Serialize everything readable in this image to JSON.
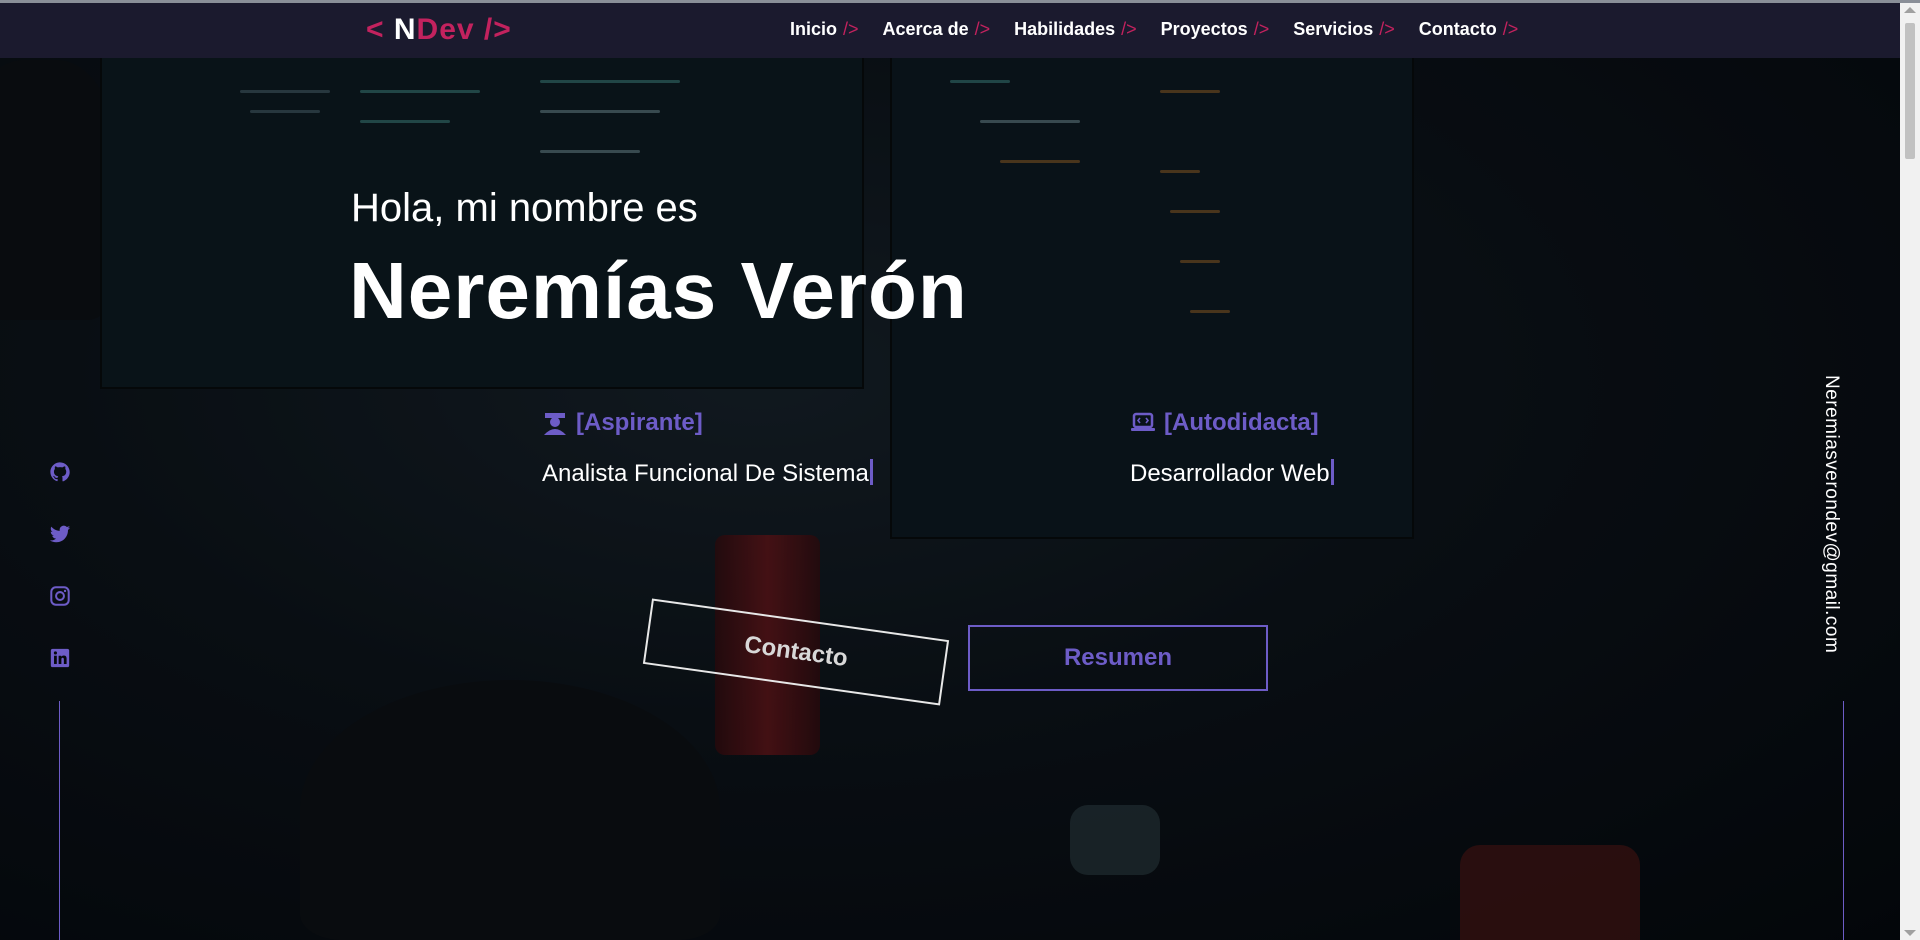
{
  "brand": {
    "left": "< ",
    "initial": "N",
    "rest": "Dev",
    "right": " />"
  },
  "nav": [
    {
      "label": "Inicio",
      "tag": "/>"
    },
    {
      "label": "Acerca de",
      "tag": "/>"
    },
    {
      "label": "Habilidades",
      "tag": "/>"
    },
    {
      "label": "Proyectos",
      "tag": "/>"
    },
    {
      "label": "Servicios",
      "tag": "/>"
    },
    {
      "label": "Contacto",
      "tag": "/>"
    }
  ],
  "hero": {
    "greeting": "Hola, mi nombre es",
    "name": "Neremías Verón",
    "roles": [
      {
        "icon": "graduate-icon",
        "title": "[Aspirante]",
        "text": "Analista Funcional De Sistema"
      },
      {
        "icon": "laptop-code-icon",
        "title": "[Autodidacta]",
        "text": "Desarrollador Web"
      }
    ],
    "buttons": {
      "contact": "Contacto",
      "resume": "Resumen"
    }
  },
  "social": [
    "github-icon",
    "twitter-icon",
    "instagram-icon",
    "linkedin-icon"
  ],
  "email": "Neremiasverondev@gmail.com",
  "colors": {
    "accent": "#6d5cc7",
    "brand": "#c3225e",
    "navbar": "#1b1a2e"
  }
}
